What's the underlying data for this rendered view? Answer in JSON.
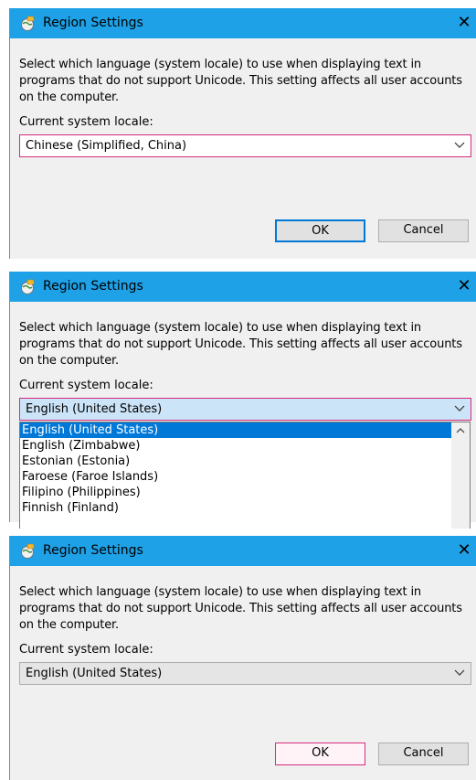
{
  "dialogs": [
    {
      "title": "Region Settings",
      "description": "Select which language (system locale) to use when displaying text in programs that do not support Unicode. This setting affects all user accounts on the computer.",
      "locale_label": "Current system locale:",
      "locale_value": "Chinese (Simplified, China)",
      "ok_label": "OK",
      "cancel_label": "Cancel"
    },
    {
      "title": "Region Settings",
      "description": "Select which language (system locale) to use when displaying text in programs that do not support Unicode. This setting affects all user accounts on the computer.",
      "locale_label": "Current system locale:",
      "locale_value": "English (United States)",
      "dropdown_options": [
        "English (United States)",
        "English (Zimbabwe)",
        "Estonian (Estonia)",
        "Faroese (Faroe Islands)",
        "Filipino (Philippines)",
        "Finnish (Finland)"
      ]
    },
    {
      "title": "Region Settings",
      "description": "Select which language (system locale) to use when displaying text in programs that do not support Unicode. This setting affects all user accounts on the computer.",
      "locale_label": "Current system locale:",
      "locale_value": "English (United States)",
      "ok_label": "OK",
      "cancel_label": "Cancel"
    }
  ],
  "colors": {
    "titlebar": "#1ea1e6",
    "focus_ring": "#d52a7c",
    "default_button_border": "#0078d7",
    "selected_option": "#0078d7",
    "dialog_bg": "#f0f0f0"
  },
  "icons": {
    "app": "region-globe-icon",
    "close": "close-icon",
    "dropdown": "chevron-down-icon",
    "scroll_up": "scroll-up-icon"
  }
}
